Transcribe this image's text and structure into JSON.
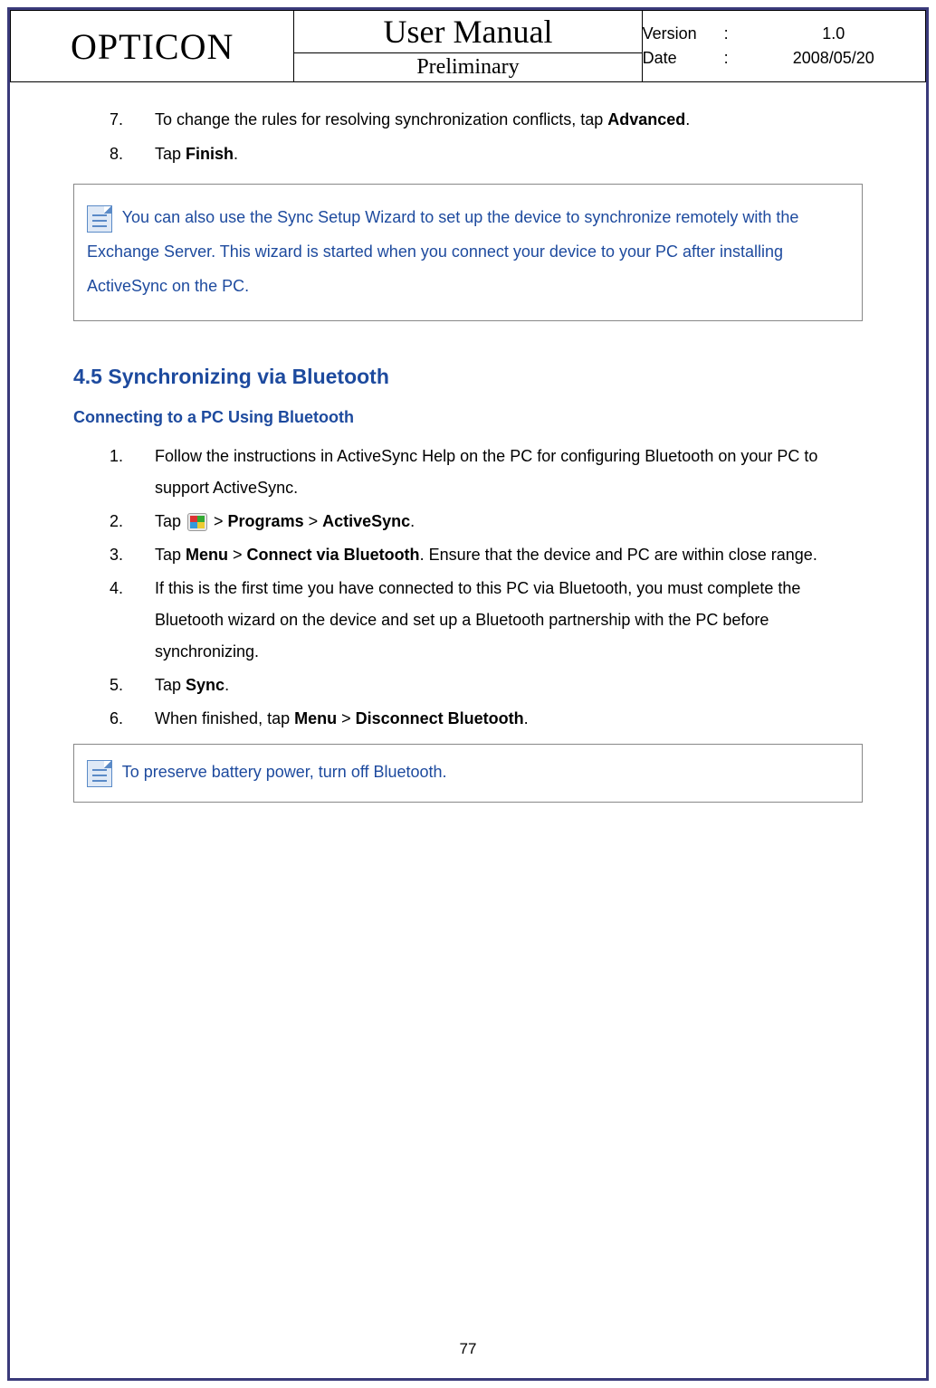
{
  "header": {
    "brand": "OPTICON",
    "title": "User Manual",
    "subtitle": "Preliminary",
    "version_label": "Version",
    "version_value": "1.0",
    "date_label": "Date",
    "date_value": "2008/05/20"
  },
  "steps_top": [
    {
      "num": "7.",
      "pre": "To change the rules for resolving synchronization conflicts, tap ",
      "bold": "Advanced",
      "post": "."
    },
    {
      "num": "8.",
      "pre": "Tap ",
      "bold": "Finish",
      "post": "."
    }
  ],
  "note1": "You can also use the Sync Setup Wizard to set up the device to synchronize remotely with the Exchange Server. This wizard is started when you connect your device to your PC after installing ActiveSync on the PC.",
  "section": {
    "title": "4.5 Synchronizing via Bluetooth",
    "subtitle": "Connecting to a PC Using Bluetooth"
  },
  "steps_sec": {
    "s1": {
      "num": "1.",
      "text": "Follow the instructions in ActiveSync Help on the PC for configuring Bluetooth on your PC to support ActiveSync."
    },
    "s2": {
      "num": "2.",
      "pre": "Tap ",
      "mid1": " > ",
      "b1": "Programs",
      "mid2": " > ",
      "b2": "ActiveSync",
      "post": "."
    },
    "s3": {
      "num": "3.",
      "pre": "Tap ",
      "b1": "Menu",
      "mid1": " > ",
      "b2": "Connect via Bluetooth",
      "post": ". Ensure that the device and PC are within close range."
    },
    "s4": {
      "num": "4.",
      "text": "If this is the first time you have connected to this PC via Bluetooth, you must complete the Bluetooth wizard on the device and set up a Bluetooth partnership with the PC before synchronizing."
    },
    "s5": {
      "num": "5.",
      "pre": "Tap ",
      "b1": "Sync",
      "post": "."
    },
    "s6": {
      "num": "6.",
      "pre": "When finished, tap ",
      "b1": "Menu",
      "mid1": " > ",
      "b2": "Disconnect Bluetooth",
      "post": "."
    }
  },
  "note2": "To preserve battery power, turn off Bluetooth.",
  "page_number": "77"
}
